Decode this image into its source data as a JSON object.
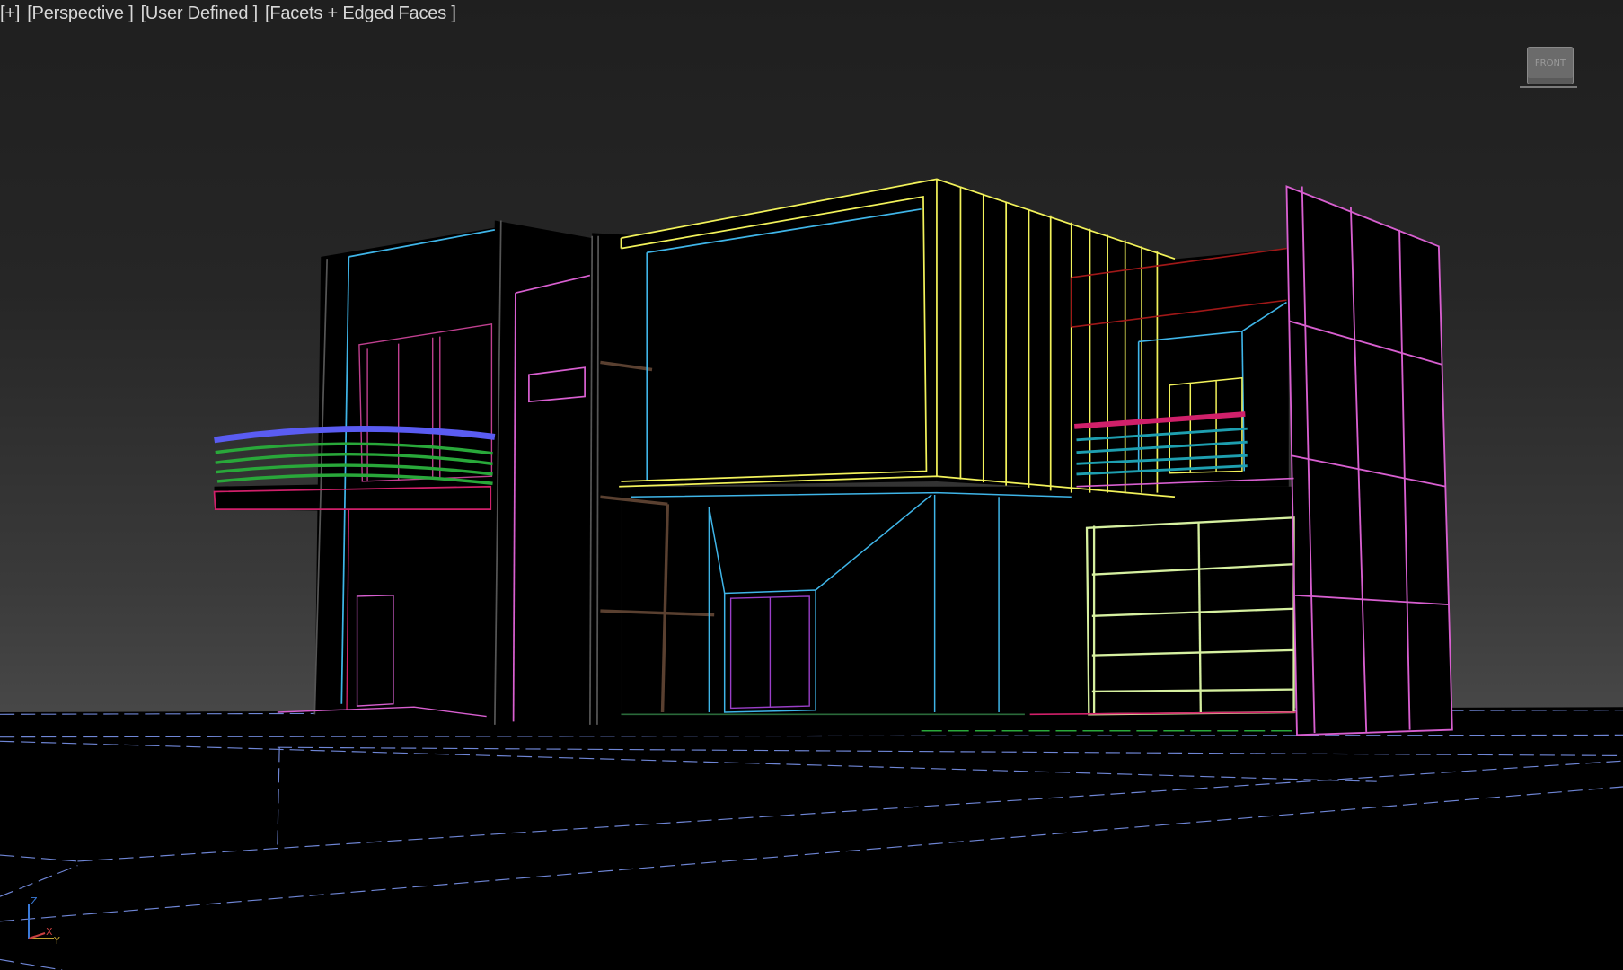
{
  "viewport": {
    "labels": [
      "[+]",
      "[Perspective ]",
      "[User Defined ]",
      "[Facets + Edged Faces ]"
    ],
    "viewcube_face": "FRONT",
    "axis_labels": {
      "x": "X",
      "y": "Y",
      "z": "Z"
    }
  },
  "colors": {
    "background_top": "#1f1f1f",
    "background_horizon": "#4b4b4b",
    "ground": "#000000",
    "grid_lines": "#6f86d6",
    "wire_yellow": "#f2f25a",
    "wire_cyan": "#3fb5e8",
    "wire_magenta": "#d85fd0",
    "wire_pink": "#d0206a",
    "wire_green": "#29a83a",
    "wire_blue": "#5a5cf2",
    "wire_brown": "#5a4030",
    "wire_lime": "#d6f0a0",
    "wire_red": "#a01818",
    "wire_teal": "#1e9fb0"
  },
  "icons": [
    "viewcube-icon",
    "axis-tripod-icon"
  ]
}
